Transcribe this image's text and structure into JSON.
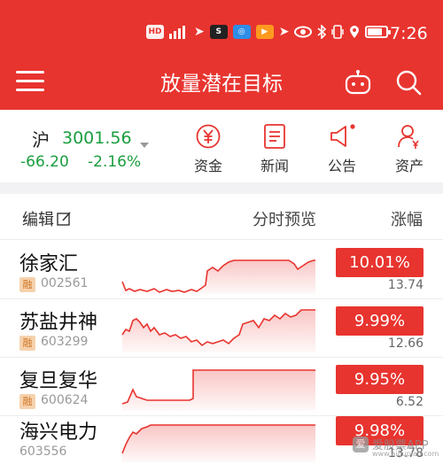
{
  "status_bar": {
    "time": "7:26",
    "icons": [
      "hd-icon",
      "signal-5g-icon",
      "send-icon",
      "app-sohu-icon",
      "app-blue-icon",
      "app-orange-icon",
      "send-icon",
      "eye-icon",
      "bluetooth-icon",
      "vibrate-icon",
      "location-icon",
      "battery-icon"
    ],
    "hd_label": "HD",
    "battery_level": 0.8
  },
  "header": {
    "title": "放量潜在目标",
    "background": "#e8342f"
  },
  "index": {
    "name": "沪",
    "value": "3001.56",
    "change": "-66.20",
    "change_pct": "-2.16%",
    "color": "#1a9e3e"
  },
  "quick_actions": [
    {
      "label": "资金",
      "icon": "yuan-icon"
    },
    {
      "label": "新闻",
      "icon": "news-icon"
    },
    {
      "label": "公告",
      "icon": "megaphone-icon"
    },
    {
      "label": "资产",
      "icon": "user-assets-icon"
    }
  ],
  "list_header": {
    "edit": "编辑",
    "preview": "分时预览",
    "change": "涨幅"
  },
  "stocks": [
    {
      "name": "徐家汇",
      "margin": "融",
      "code": "002561",
      "change_pct": "10.01%",
      "price": "13.74",
      "has_margin": true
    },
    {
      "name": "苏盐井神",
      "margin": "融",
      "code": "603299",
      "change_pct": "9.99%",
      "price": "12.66",
      "has_margin": true
    },
    {
      "name": "复旦复华",
      "margin": "融",
      "code": "600624",
      "change_pct": "9.95%",
      "price": "6.52",
      "has_margin": true
    },
    {
      "name": "海兴电力",
      "margin": "",
      "code": "603556",
      "change_pct": "9.98%",
      "price": "13.78",
      "has_margin": false
    }
  ],
  "colors": {
    "up": "#e8342f",
    "down": "#1a9e3e",
    "margin_badge": "#f6d2ad"
  },
  "watermark": {
    "text": "爱股票APP",
    "logo": "爱",
    "url": "www.aigupiao.com"
  }
}
